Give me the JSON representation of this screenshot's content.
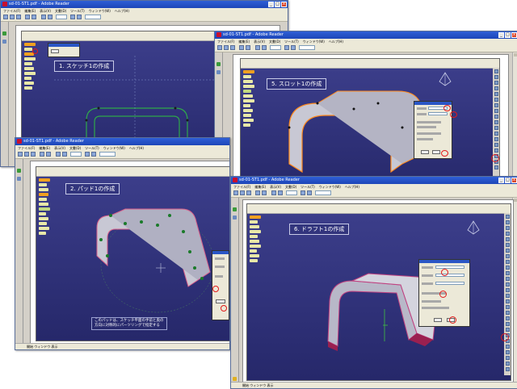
{
  "windows": [
    {
      "id": "w1",
      "title": "sd-01-ST1.pdf - Adobe Reader",
      "caption": "1. スケッチ1の作成"
    },
    {
      "id": "w2",
      "title": "sd-01-ST1.pdf - Adobe Reader",
      "caption": "5. スロット1の作成"
    },
    {
      "id": "w3",
      "title": "sd-01-ST1.pdf - Adobe Reader",
      "caption": "2. パッド1の作成",
      "note_lines": [
        "このパッドは、スケッチ平面の手前と奥の",
        "方向に対称的にパーツリングで指定する"
      ]
    },
    {
      "id": "w4",
      "title": "sd-01-ST1.pdf - Adobe Reader",
      "caption": "6. ドラフト1の作成"
    }
  ],
  "menu": [
    "ファイル(F)",
    "編集(E)",
    "表示(V)",
    "文書(D)",
    "ツール(T)",
    "ウィンドウ(W)",
    "ヘルプ(H)"
  ],
  "window_buttons": {
    "min": "_",
    "max": "□",
    "close": "x"
  },
  "status_text": "開始 ウィンドウ 表示",
  "colors": {
    "titlebar": "#1d46b8",
    "catia_bg": "#2f3178",
    "sketch_green": "#2fa84a",
    "highlight_red": "#e21a1a",
    "part_orange": "#ff8a1e",
    "part_body": "#c8c8d4"
  }
}
